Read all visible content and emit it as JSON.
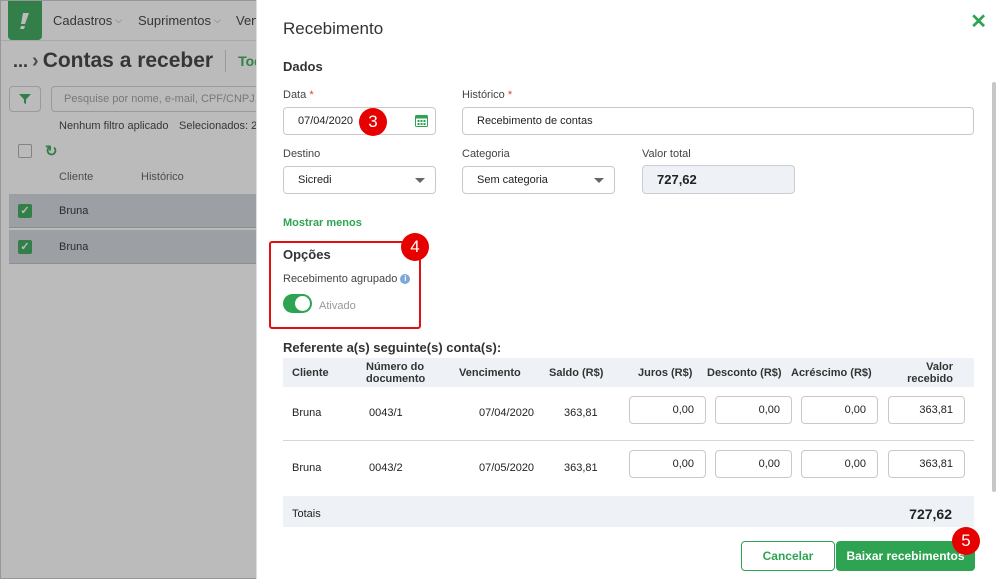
{
  "topbar": {
    "menu": [
      {
        "label": "Cadastros"
      },
      {
        "label": "Suprimentos"
      },
      {
        "label": "Ven"
      }
    ]
  },
  "list_page": {
    "breadcrumb": "...",
    "title": "Contas a receber",
    "tab": "Tod",
    "search_placeholder": "Pesquise por nome, e-mail, CPF/CNPJ, ...",
    "no_filter": "Nenhum filtro aplicado",
    "selected": "Selecionados: 2",
    "columns": {
      "cliente": "Cliente",
      "historico": "Histórico"
    },
    "rows": [
      {
        "name": "Bruna"
      },
      {
        "name": "Bruna"
      }
    ]
  },
  "modal": {
    "title": "Recebimento",
    "dados_title": "Dados",
    "data_label": "Data",
    "data_value": "07/04/2020",
    "historico_label": "Histórico",
    "historico_value": "Recebimento de contas",
    "destino_label": "Destino",
    "destino_value": "Sicredi",
    "categoria_label": "Categoria",
    "categoria_value": "Sem categoria",
    "valor_total_label": "Valor total",
    "valor_total_value": "727,62",
    "show_less": "Mostrar menos",
    "opcoes_title": "Opções",
    "agrupado_label": "Recebimento agrupado",
    "toggle_state": "Ativado",
    "ref_title": "Referente a(s) seguinte(s) conta(s):",
    "table": {
      "headers": {
        "cliente": "Cliente",
        "numero_l1": "Número do",
        "numero_l2": "documento",
        "vencimento": "Vencimento",
        "saldo": "Saldo (R$)",
        "juros": "Juros (R$)",
        "desconto": "Desconto (R$)",
        "acrescimo": "Acréscimo (R$)",
        "valor_l1": "Valor",
        "valor_l2": "recebido"
      },
      "rows": [
        {
          "cliente": "Bruna",
          "documento": "0043/1",
          "vencimento": "07/04/2020",
          "saldo": "363,81",
          "juros": "0,00",
          "desconto": "0,00",
          "acrescimo": "0,00",
          "valor": "363,81"
        },
        {
          "cliente": "Bruna",
          "documento": "0043/2",
          "vencimento": "07/05/2020",
          "saldo": "363,81",
          "juros": "0,00",
          "desconto": "0,00",
          "acrescimo": "0,00",
          "valor": "363,81"
        }
      ],
      "totals_label": "Totais",
      "totals_value": "727,62"
    },
    "cancel_label": "Cancelar",
    "confirm_label": "Baixar recebimentos"
  },
  "annotations": {
    "badge3": "3",
    "badge4": "4",
    "badge5": "5"
  },
  "colors": {
    "accent": "#2ea452",
    "annotation": "#e60000",
    "overlay": "rgba(60,60,60,0.35)"
  }
}
